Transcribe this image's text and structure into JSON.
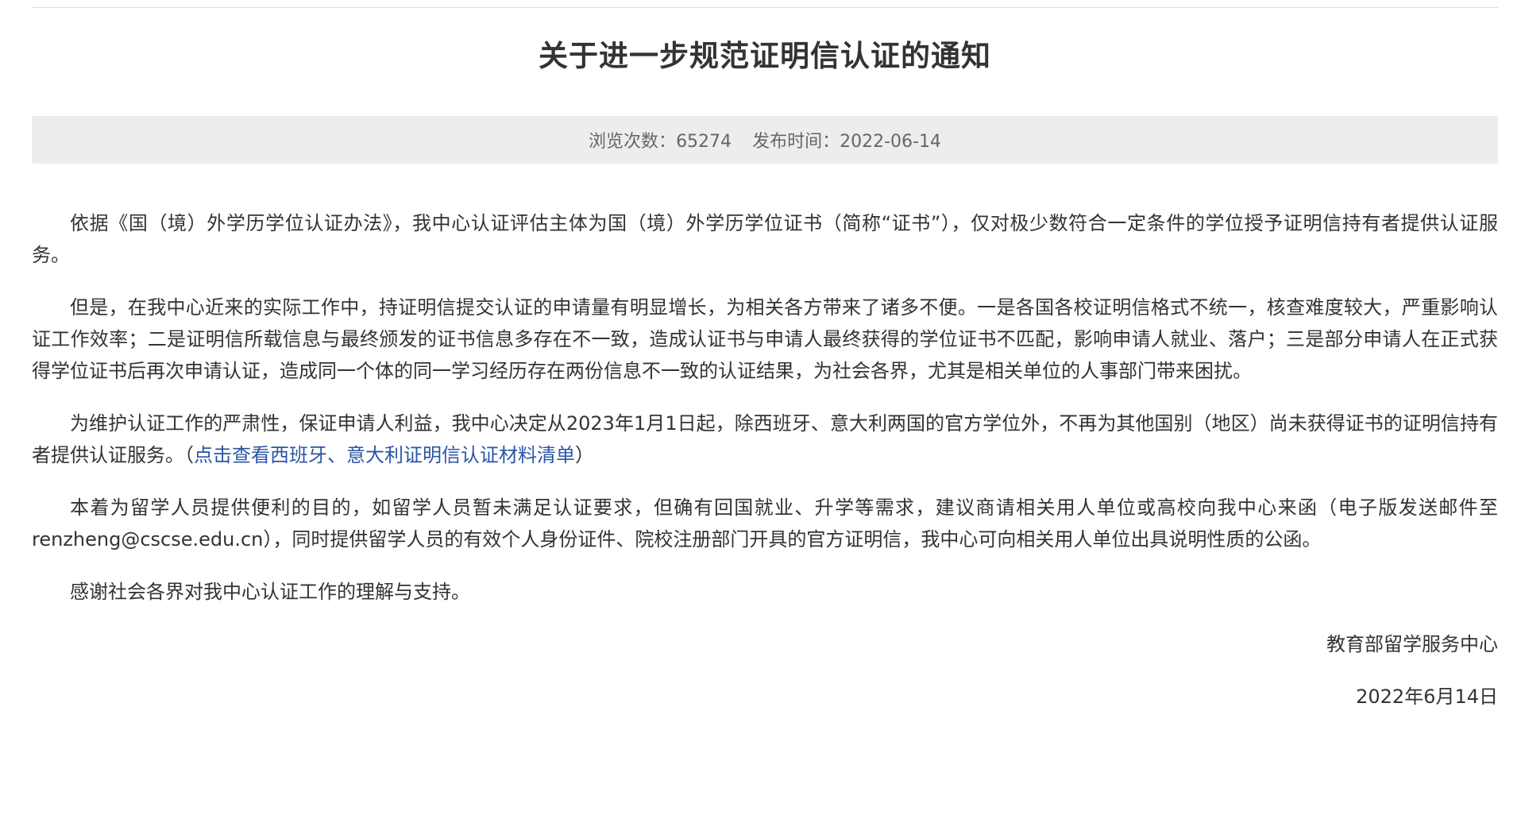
{
  "article": {
    "title": "关于进一步规范证明信认证的通知",
    "meta": {
      "views_label": "浏览次数：",
      "views_value": "65274",
      "date_label": "发布时间：",
      "date_value": "2022-06-14"
    },
    "paragraphs": [
      "依据《国（境）外学历学位认证办法》，我中心认证评估主体为国（境）外学历学位证书（简称“证书”），仅对极少数符合一定条件的学位授予证明信持有者提供认证服务。",
      "但是，在我中心近来的实际工作中，持证明信提交认证的申请量有明显增长，为相关各方带来了诸多不便。一是各国各校证明信格式不统一，核查难度较大，严重影响认证工作效率；二是证明信所载信息与最终颁发的证书信息多存在不一致，造成认证书与申请人最终获得的学位证书不匹配，影响申请人就业、落户；三是部分申请人在正式获得学位证书后再次申请认证，造成同一个体的同一学习经历存在两份信息不一致的认证结果，为社会各界，尤其是相关单位的人事部门带来困扰。"
    ],
    "paragraph3": {
      "text": "为维护认证工作的严肃性，保证申请人利益，我中心决定从2023年1月1日起，除西班牙、意大利两国的官方学位外，不再为其他国别（地区）尚未获得证书的证明信持有者提供认证服务。",
      "link_open": "（",
      "link_text": "点击查看西班牙、意大利证明信认证材料清单",
      "link_close": "）"
    },
    "paragraph4": "本着为留学人员提供便利的目的，如留学人员暂未满足认证要求，但确有回国就业、升学等需求，建议商请相关用人单位或高校向我中心来函（电子版发送邮件至renzheng@cscse.edu.cn），同时提供留学人员的有效个人身份证件、院校注册部门开具的官方证明信，我中心可向相关用人单位出具说明性质的公函。",
    "paragraph5": "感谢社会各界对我中心认证工作的理解与支持。",
    "signature": {
      "organization": "教育部留学服务中心",
      "date": "2022年6月14日"
    }
  }
}
